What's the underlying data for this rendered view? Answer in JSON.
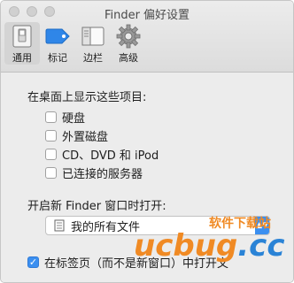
{
  "window": {
    "title": "Finder 偏好设置"
  },
  "toolbar": {
    "items": [
      {
        "label": "通用",
        "icon": "switch-icon",
        "active": true
      },
      {
        "label": "标记",
        "icon": "tag-icon",
        "active": false
      },
      {
        "label": "边栏",
        "icon": "sidebar-icon",
        "active": false
      },
      {
        "label": "高级",
        "icon": "gear-icon",
        "active": false
      }
    ]
  },
  "desktop_section": {
    "heading": "在桌面上显示这些项目:",
    "options": [
      {
        "label": "硬盘",
        "checked": false
      },
      {
        "label": "外置磁盘",
        "checked": false
      },
      {
        "label": "CD、DVD 和 iPod",
        "checked": false
      },
      {
        "label": "已连接的服务器",
        "checked": false
      }
    ]
  },
  "new_window_section": {
    "heading": "开启新 Finder 窗口时打开:",
    "selected": "我的所有文件"
  },
  "tabs_option": {
    "label": "在标签页（而不是新窗口）中打开文",
    "checked": true
  },
  "watermark": {
    "cn": "软件下载站",
    "logo_a": "ucbug",
    "logo_b": ".cc"
  },
  "colors": {
    "accent": "#3b8ff0",
    "watermark_orange": "#f08a24",
    "watermark_blue": "#2a83d6"
  }
}
